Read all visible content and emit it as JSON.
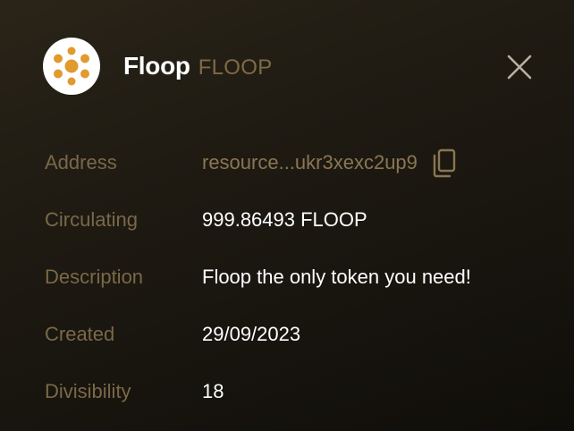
{
  "header": {
    "token_name": "Floop",
    "token_symbol": "FLOOP",
    "logo_icon": "floop-dots-logo",
    "close_icon": "close-x-icon"
  },
  "details": {
    "address": {
      "label": "Address",
      "value": "resource...ukr3xexc2up9",
      "action_icon": "copy-icon"
    },
    "circulating": {
      "label": "Circulating",
      "value": "999.86493 FLOOP"
    },
    "description": {
      "label": "Description",
      "value": "Floop the only token you need!"
    },
    "created": {
      "label": "Created",
      "value": "29/09/2023"
    },
    "divisibility": {
      "label": "Divisibility",
      "value": "18"
    }
  },
  "colors": {
    "background": "#1b1710",
    "label": "#7a6848",
    "value": "#ffffff",
    "accent": "#8a7652",
    "logo_dots": "#e09a2e"
  }
}
